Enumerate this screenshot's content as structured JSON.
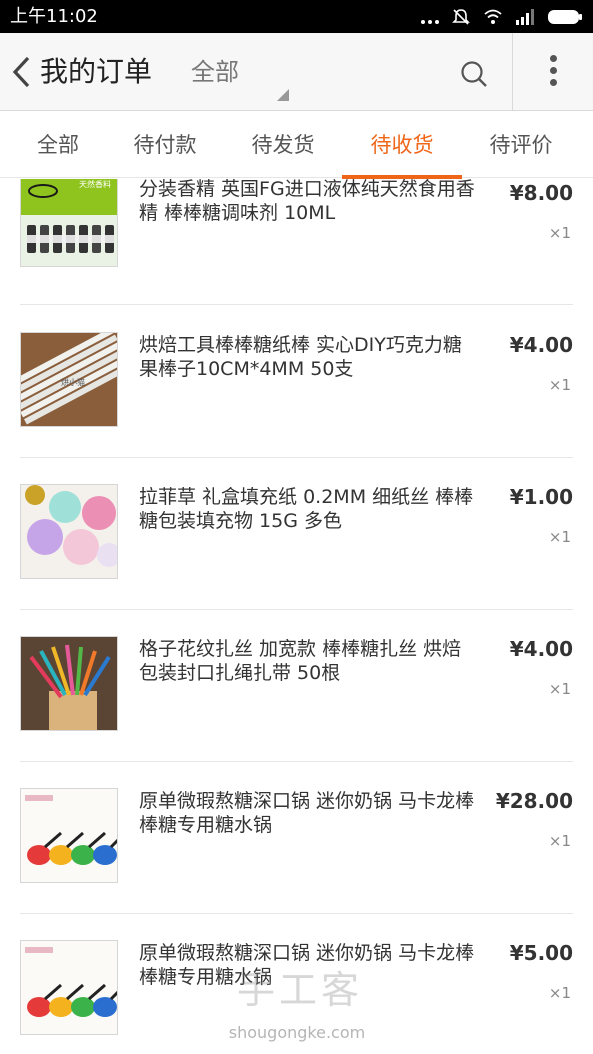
{
  "statusbar": {
    "time": "上午11:02"
  },
  "header": {
    "title": "我的订单",
    "filter": "全部"
  },
  "tabs": [
    {
      "label": "全部"
    },
    {
      "label": "待付款"
    },
    {
      "label": "待发货"
    },
    {
      "label": "待收货",
      "active": true
    },
    {
      "label": "待评价"
    }
  ],
  "orders": [
    {
      "name": "分装香精 英国FG进口液体纯天然食用香精 棒棒糖调味剂 10ML",
      "price": "¥8.00",
      "qty": "×1",
      "thumb_text": "天然香料"
    },
    {
      "name": "烘焙工具棒棒糖纸棒 实心DIY巧克力糖果棒子10CM*4MM 50支",
      "price": "¥4.00",
      "qty": "×1",
      "thumb_text": "烘小猫"
    },
    {
      "name": "拉菲草 礼盒填充纸 0.2MM 细纸丝 棒棒糖包装填充物 15G 多色",
      "price": "¥1.00",
      "qty": "×1"
    },
    {
      "name": "格子花纹扎丝 加宽款 棒棒糖扎丝 烘焙包装封口扎绳扎带 50根",
      "price": "¥4.00",
      "qty": "×1"
    },
    {
      "name": "原单微瑕熬糖深口锅 迷你奶锅 马卡龙棒棒糖专用糖水锅",
      "price": "¥28.00",
      "qty": "×1"
    },
    {
      "name": "原单微瑕熬糖深口锅 迷你奶锅 马卡龙棒棒糖专用糖水锅",
      "price": "¥5.00",
      "qty": "×1"
    }
  ],
  "watermark": {
    "brand": "手工客",
    "url": "shougongke.com"
  },
  "colors": {
    "accent": "#ef6619",
    "header_bg": "#f7f7f7",
    "divider": "#e6e6e6"
  }
}
